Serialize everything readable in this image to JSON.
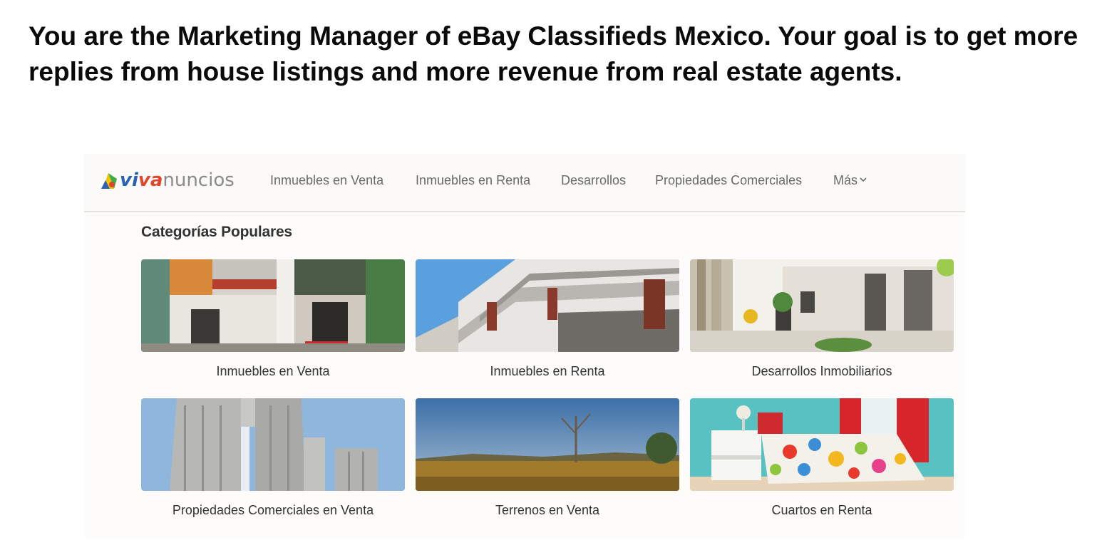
{
  "slide": {
    "heading": "You are the Marketing Manager of eBay Classifieds Mexico. Your goal is to get more replies from house listings and more revenue from real estate agents."
  },
  "site": {
    "logo": {
      "viva": "viva",
      "va": "va",
      "nuncios": "nuncios",
      "icon": "logo-mark-icon"
    },
    "nav": [
      {
        "label": "Inmuebles en Venta"
      },
      {
        "label": "Inmuebles en Renta"
      },
      {
        "label": "Desarrollos"
      },
      {
        "label": "Propiedades Comerciales"
      },
      {
        "label": "Más"
      }
    ],
    "section_title": "Categorías Populares",
    "categories": [
      {
        "label": "Inmuebles en Venta",
        "image": "modern-house-exterior"
      },
      {
        "label": "Inmuebles en Renta",
        "image": "apartment-balconies"
      },
      {
        "label": "Desarrollos Inmobiliarios",
        "image": "residential-courtyard"
      },
      {
        "label": "Propiedades Comerciales en Venta",
        "image": "office-towers"
      },
      {
        "label": "Terrenos en Venta",
        "image": "open-field-land"
      },
      {
        "label": "Cuartos en Renta",
        "image": "colorful-bedroom"
      }
    ]
  },
  "colors": {
    "brand_blue": "#2b61b4",
    "brand_red": "#e0452b",
    "nav_text": "#6a6a6a",
    "heading": "#0a0a0a"
  }
}
